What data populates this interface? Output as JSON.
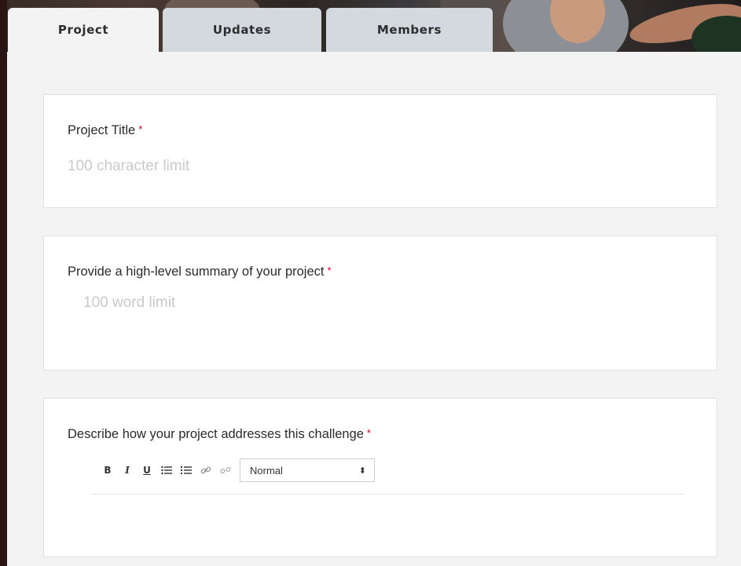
{
  "tabs": [
    {
      "label": "Project"
    },
    {
      "label": "Updates"
    },
    {
      "label": "Members"
    }
  ],
  "form": {
    "title_field": {
      "label": "Project Title",
      "required_mark": "*",
      "placeholder": "100 character limit",
      "value": ""
    },
    "summary_field": {
      "label": "Provide a high-level summary of your project",
      "required_mark": "*",
      "placeholder": "100 word limit",
      "value": ""
    },
    "challenge_field": {
      "label": "Describe how your project addresses this challenge",
      "required_mark": "*"
    }
  },
  "toolbar": {
    "bold": "B",
    "italic": "I",
    "underline": "U",
    "bullet_list": "☰",
    "ordered_list": "☰",
    "link": "%",
    "unlink": "⚯",
    "format_select": {
      "value": "Normal",
      "arrow": "⬍"
    }
  },
  "colors": {
    "required": "#d0021b",
    "tab_inactive": "#d3d9de",
    "page_bg": "#f3f3f3"
  }
}
